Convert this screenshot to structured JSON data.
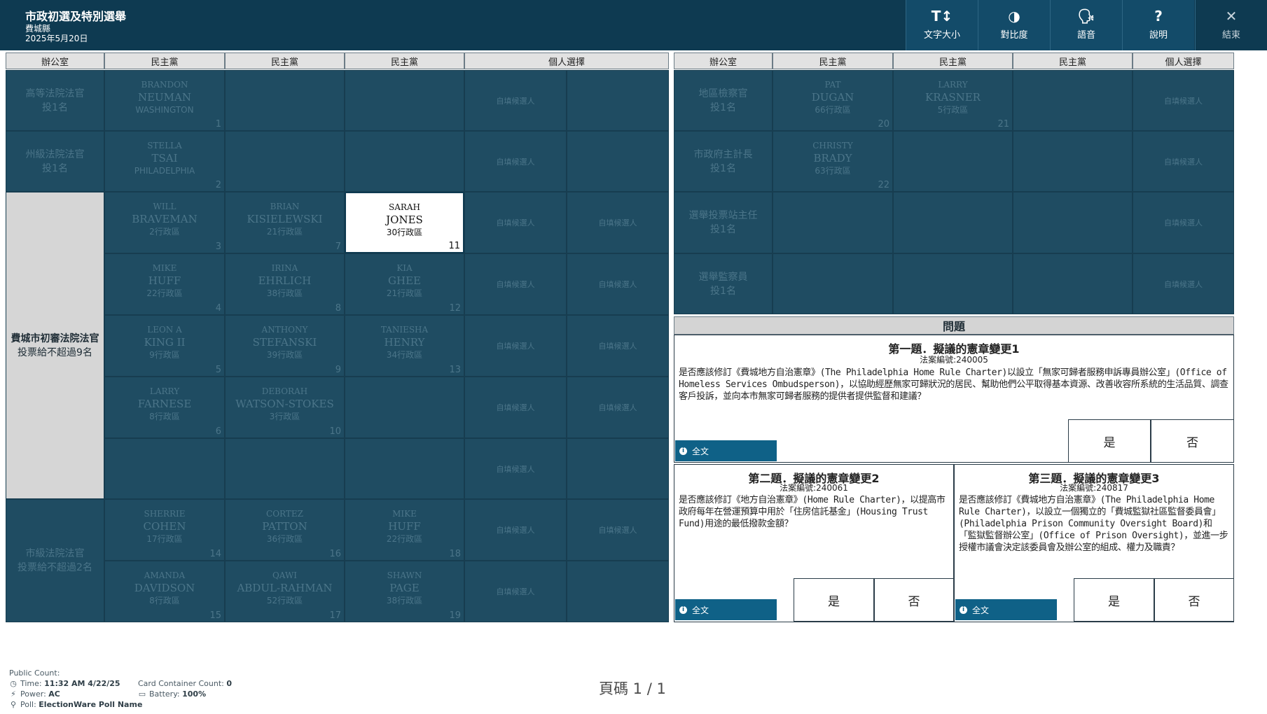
{
  "header": {
    "title": "市政初選及特別選舉",
    "county": "費城縣",
    "date": "2025年5月20日",
    "buttons": [
      {
        "id": "text-size",
        "icon": "T↕",
        "label": "文字大小"
      },
      {
        "id": "contrast",
        "icon": "◑",
        "label": "對比度"
      },
      {
        "id": "audio",
        "icon": "🗣",
        "label": "語音"
      },
      {
        "id": "help",
        "icon": "?",
        "label": "說明"
      },
      {
        "id": "exit",
        "icon": "✕",
        "label": "結束"
      }
    ]
  },
  "columns": {
    "office": "辦公室",
    "democratic": "民主黨",
    "write_in": "個人選擇"
  },
  "write_in_label": "自填候選人",
  "left_offices": {
    "superior": {
      "name": "高等法院法官",
      "vote": "投1名"
    },
    "commonwealth": {
      "name": "州級法院法官",
      "vote": "投1名"
    },
    "common_pleas": {
      "name": "費城市初審法院法官",
      "vote": "投票給不超過9名"
    },
    "municipal": {
      "name": "市級法院法官",
      "vote": "投票給不超過2名"
    }
  },
  "right_offices": {
    "da": {
      "name": "地區檢察官",
      "vote": "投1名"
    },
    "controller": {
      "name": "市政府主計長",
      "vote": "投1名"
    },
    "judge_election": {
      "name": "選舉投票站主任",
      "vote": "投1名"
    },
    "inspector": {
      "name": "選舉監察員",
      "vote": "投1名"
    }
  },
  "candidates": {
    "c1": {
      "first": "BRANDON",
      "last": "NEUMAN",
      "district": "WASHINGTON",
      "num": "1"
    },
    "c2": {
      "first": "STELLA",
      "last": "TSAI",
      "district": "PHILADELPHIA",
      "num": "2"
    },
    "c3": {
      "first": "WILL",
      "last": "BRAVEMAN",
      "district": "2行政區",
      "num": "3"
    },
    "c4": {
      "first": "MIKE",
      "last": "HUFF",
      "district": "22行政區",
      "num": "4"
    },
    "c5": {
      "first": "LEON A",
      "last": "KING II",
      "district": "9行政區",
      "num": "5"
    },
    "c6": {
      "first": "LARRY",
      "last": "FARNESE",
      "district": "8行政區",
      "num": "6"
    },
    "c7": {
      "first": "BRIAN",
      "last": "KISIELEWSKI",
      "district": "21行政區",
      "num": "7"
    },
    "c8": {
      "first": "IRINA",
      "last": "EHRLICH",
      "district": "38行政區",
      "num": "8"
    },
    "c9": {
      "first": "ANTHONY",
      "last": "STEFANSKI",
      "district": "39行政區",
      "num": "9"
    },
    "c10": {
      "first": "DEBORAH",
      "last": "WATSON-STOKES",
      "district": "3行政區",
      "num": "10"
    },
    "c11": {
      "first": "SARAH",
      "last": "JONES",
      "district": "30行政區",
      "num": "11"
    },
    "c12": {
      "first": "KIA",
      "last": "GHEE",
      "district": "21行政區",
      "num": "12"
    },
    "c13": {
      "first": "TANIESHA",
      "last": "HENRY",
      "district": "34行政區",
      "num": "13"
    },
    "c14": {
      "first": "SHERRIE",
      "last": "COHEN",
      "district": "17行政區",
      "num": "14"
    },
    "c15": {
      "first": "AMANDA",
      "last": "DAVIDSON",
      "district": "8行政區",
      "num": "15"
    },
    "c16": {
      "first": "CORTEZ",
      "last": "PATTON",
      "district": "36行政區",
      "num": "16"
    },
    "c17": {
      "first": "QAWI",
      "last": "ABDUL-RAHMAN",
      "district": "52行政區",
      "num": "17"
    },
    "c18": {
      "first": "MIKE",
      "last": "HUFF",
      "district": "22行政區",
      "num": "18"
    },
    "c19": {
      "first": "SHAWN",
      "last": "PAGE",
      "district": "38行政區",
      "num": "19"
    },
    "c20": {
      "first": "PAT",
      "last": "DUGAN",
      "district": "66行政區",
      "num": "20"
    },
    "c21": {
      "first": "LARRY",
      "last": "KRASNER",
      "district": "5行政區",
      "num": "21"
    },
    "c22": {
      "first": "CHRISTY",
      "last": "BRADY",
      "district": "63行政區",
      "num": "22"
    }
  },
  "questions": {
    "header": "問題",
    "yes": "是",
    "no": "否",
    "full_text": "全文",
    "q1": {
      "title": "第一題．擬議的憲章變更1",
      "number": "法案編號:240005",
      "text": "是否應該修訂《費城地方自治憲章》(The Philadelphia Home Rule Charter)以設立「無家可歸者服務申訴專員辦公室」(Office of Homeless Services Ombudsperson)，以協助經歷無家可歸狀況的居民、幫助他們公平取得基本資源、改善收容所系統的生活品質、調查客戶投訴，並向本市無家可歸者服務的提供者提供監督和建議？"
    },
    "q2": {
      "title": "第二題．擬議的憲章變更2",
      "number": "法案編號:240061",
      "text": "是否應該修訂《地方自治憲章》(Home Rule Charter)，以提高市政府每年在營運預算中用於「住房信託基金」(Housing Trust Fund)用途的最低撥款金額？"
    },
    "q3": {
      "title": "第三題．擬議的憲章變更3",
      "number": "法案編號:240817",
      "text": "是否應該修訂《費城地方自治憲章》(The Philadelphia Home Rule Charter)，以設立一個獨立的「費城監獄社區監督委員會」(Philadelphia Prison Community Oversight Board)和「監獄監督辦公室」(Office of Prison Oversight)，並進一步授權市議會決定該委員會及辦公室的組成、權力及職責？"
    }
  },
  "footer": {
    "public_count_label": "Public Count:",
    "time_label": "Time:",
    "time_value": "11:32 AM 4/22/25",
    "power_label": "Power:",
    "power_value": "AC",
    "poll_label": "Poll:",
    "poll_value": "ElectionWare Poll Name",
    "card_label": "Card Container Count:",
    "card_value": "0",
    "battery_label": "Battery:",
    "battery_value": "100%",
    "page": "頁碼 1 / 1"
  }
}
